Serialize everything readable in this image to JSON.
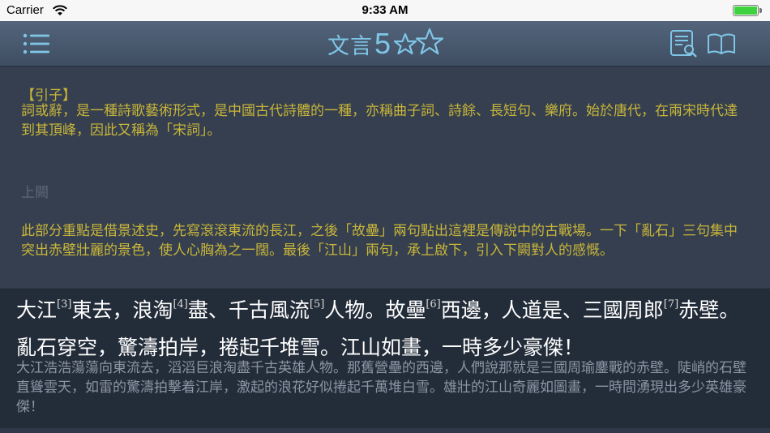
{
  "status_bar": {
    "carrier": "Carrier",
    "time": "9:33 AM",
    "battery_level": 1.0
  },
  "nav": {
    "title": "文言",
    "title_number": "5",
    "star_icons": [
      "filled-star-icon",
      "outline-star-icon"
    ],
    "menu_icon": "list-icon",
    "search_icon": "document-search-icon",
    "book_icon": "book-icon"
  },
  "commentary": {
    "intro_heading": "【引子】",
    "intro_text": "詞或辭，是一種詩歌藝術形式，是中國古代詩體的一種，亦稱曲子詞、詩餘、長短句、樂府。始於唐代，在兩宋時代達到其頂峰，因此又稱為「宋詞」。",
    "section_label": "上闕",
    "section_text": "此部分重點是借景述史，先寫滾滾東流的長江，之後「故壘」兩句點出這裡是傳說中的古戰場。一下「亂石」三句集中突出赤壁壯麗的景色，使人心胸為之一闊。最後「江山」兩句，承上啟下，引入下闕對人的感慨。"
  },
  "poem": {
    "segments": [
      {
        "text": "大江",
        "note": "[3]"
      },
      {
        "text": "東去，浪淘",
        "note": "[4]"
      },
      {
        "text": "盡、千古風流",
        "note": "[5]"
      },
      {
        "text": "人物。故壘",
        "note": "[6]"
      },
      {
        "text": "西邊，人道是、三國周郎",
        "note": "[7]"
      },
      {
        "text": "赤壁。亂石穿空，驚濤拍岸，捲起千堆雪。江山如畫，一時多少豪傑！",
        "note": ""
      }
    ],
    "translation": "大江浩浩蕩蕩向東流去，滔滔巨浪淘盡千古英雄人物。那舊營壘的西邊，人們說那就是三國周瑜鏖戰的赤壁。陡峭的石壁直聳雲天，如雷的驚濤拍擊着江岸，激起的浪花好似捲起千萬堆白雪。雄壯的江山奇麗如圖畫，一時間湧現出多少英雄豪傑！"
  },
  "colors": {
    "accent": "#7fc6e6",
    "commentary_text": "#c9b63a",
    "section_label": "#5e6878",
    "translation": "#8c95a3",
    "poem_text": "#ffffff"
  }
}
